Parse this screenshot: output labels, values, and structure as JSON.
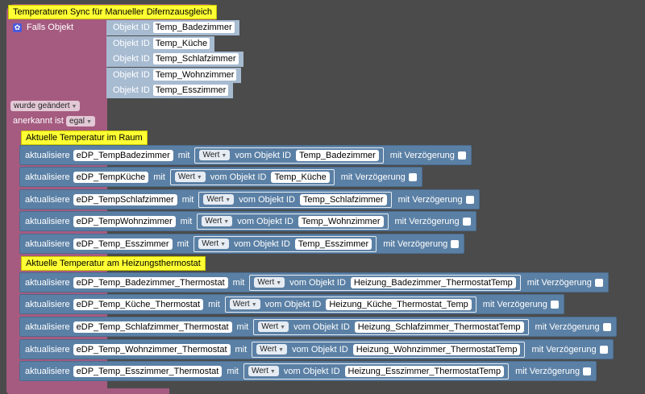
{
  "event": {
    "title": "Temperaturen Sync für Manueller Difernzausgleich",
    "falls_label": "Falls Objekt",
    "objekt_label": "Objekt ID",
    "objects": [
      "Temp_Badezimmer",
      "Temp_Küche",
      "Temp_Schlafzimmer",
      "Temp_Wohnzimmer",
      "Temp_Esszimmer"
    ],
    "trigger": "wurde geändert",
    "ack_label": "anerkannt ist",
    "ack_value": "egal"
  },
  "labels": {
    "update": "aktualisiere",
    "with": "mit",
    "value": "Wert",
    "from_object": "vom Objekt ID",
    "delay": "mit Verzögerung"
  },
  "sections": [
    {
      "title": "Aktuelle Temperatur im Raum",
      "rows": [
        {
          "target": "eDP_TempBadezimmer",
          "source": "Temp_Badezimmer"
        },
        {
          "target": "eDP_TempKüche",
          "source": "Temp_Küche"
        },
        {
          "target": "eDP_TempSchlafzimmer",
          "source": "Temp_Schlafzimmer"
        },
        {
          "target": "eDP_TempWohnzimmer",
          "source": "Temp_Wohnzimmer"
        },
        {
          "target": "eDP_Temp_Esszimmer",
          "source": "Temp_Esszimmer"
        }
      ]
    },
    {
      "title": "Aktuelle Temperatur am Heizungsthermostat",
      "rows": [
        {
          "target": "eDP_Temp_Badezimmer_Thermostat",
          "source": "Heizung_Badezimmer_ThermostatTemp"
        },
        {
          "target": "eDP_Temp_Küche_Thermostat",
          "source": "Heizung_Küche_Thermostat_Temp"
        },
        {
          "target": "eDP_Temp_Schlafzimmer_Thermostat",
          "source": "Heizung_Schlafzimmer_ThermostatTemp"
        },
        {
          "target": "eDP_Temp_Wohnzimmer_Thermostat",
          "source": "Heizung_Wohnzimmer_ThermostatTemp"
        },
        {
          "target": "eDP_Temp_Esszimmer_Thermostat",
          "source": "Heizung_Esszimmer_ThermostatTemp"
        }
      ]
    }
  ]
}
